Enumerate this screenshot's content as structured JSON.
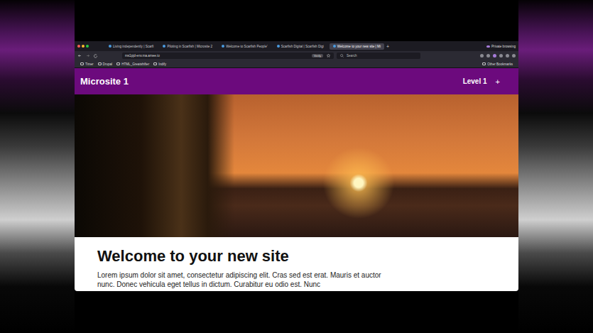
{
  "browser": {
    "tabs": [
      {
        "label": "Living independently | Scarfi",
        "selected": false
      },
      {
        "label": "Piloting in Scarfish | Microsite 2",
        "selected": false
      },
      {
        "label": "Welcome to Scarfish People'",
        "selected": false
      },
      {
        "label": "Scarfish Digital | Scarfish Digi",
        "selected": false
      },
      {
        "label": "Welcome to your new site | Mi",
        "selected": true
      }
    ],
    "new_tab": "+",
    "private_label": "Private browsing",
    "url": "ms1pjd-env.ma.amee.io",
    "verify_badge": "Verify",
    "search": {
      "placeholder": "Search"
    },
    "bookmarks": [
      "Timer",
      "Drupal",
      "HTML_Greatshifter",
      "Indify"
    ],
    "other_bookmarks": "Other Bookmarks"
  },
  "site": {
    "name": "Microsite 1",
    "nav": [
      {
        "label": "Level 1",
        "icon": "+"
      }
    ],
    "heading": "Welcome to your new site",
    "body": "Lorem ipsum dolor sit amet, consectetur adipiscing elit. Cras sed est erat. Mauris et auctor nunc. Donec vehicula eget tellus in dictum. Curabitur eu odio est. Nunc"
  }
}
